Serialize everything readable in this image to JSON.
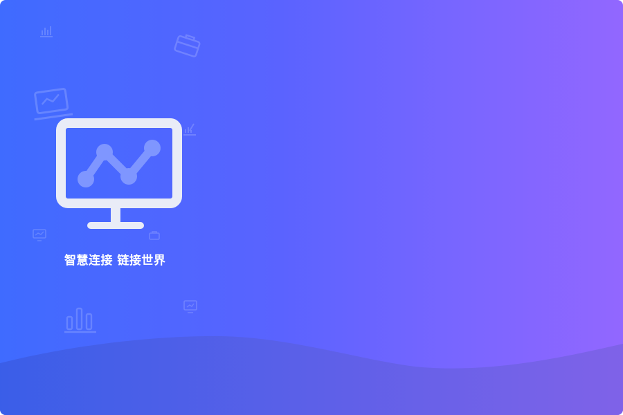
{
  "slogan": "智慧连接 链接世界",
  "colors": {
    "gradient_start": "#3f6bff",
    "gradient_end": "#9267ff",
    "monitor_stroke": "#e9ecf7",
    "monitor_line": "#7f96ff"
  },
  "icons": {
    "main": "monitor-chart-icon",
    "decorations": [
      "bar-chart-icon",
      "briefcase-icon",
      "laptop-icon",
      "pen-chart-icon",
      "small-monitor-icon",
      "small-briefcase-icon",
      "small-tv-icon",
      "bar-graph-icon"
    ]
  }
}
